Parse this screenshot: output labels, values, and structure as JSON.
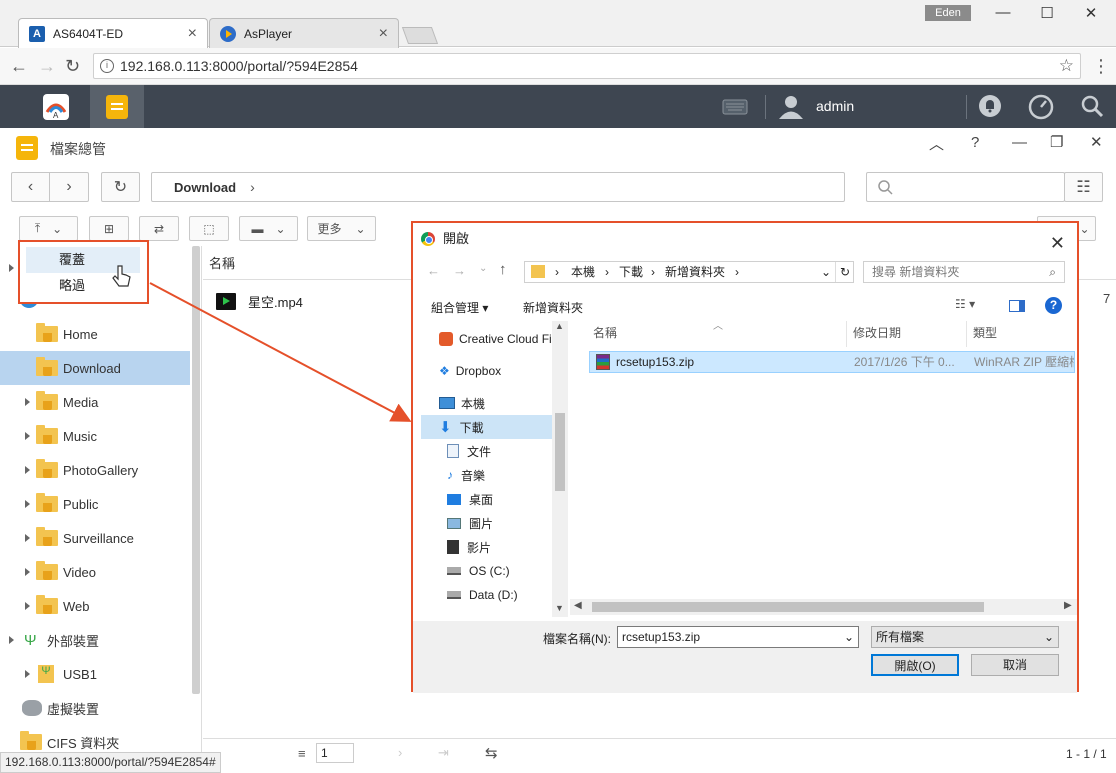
{
  "browser": {
    "tabs": [
      {
        "label": "AS6404T-ED",
        "favicon": "asustor-logo-icon"
      },
      {
        "label": "AsPlayer",
        "favicon": "play-icon"
      }
    ],
    "user_badge": "Eden",
    "url": "192.168.0.113:8000/portal/?594E2854",
    "status_url": "192.168.0.113:8000/portal/?594E2854#"
  },
  "adm": {
    "username": "admin"
  },
  "file_explorer": {
    "title": "檔案總管",
    "breadcrumb": "Download",
    "toolbar": {
      "more_label": "更多"
    },
    "context_menu": [
      "覆蓋",
      "略過"
    ],
    "sidebar": {
      "items": [
        {
          "label": "Home",
          "type": "folder",
          "expandable": false,
          "selected": false
        },
        {
          "label": "Download",
          "type": "folder",
          "expandable": false,
          "selected": true
        },
        {
          "label": "Media",
          "type": "folder",
          "expandable": true,
          "selected": false
        },
        {
          "label": "Music",
          "type": "folder",
          "expandable": true,
          "selected": false
        },
        {
          "label": "PhotoGallery",
          "type": "folder",
          "expandable": true,
          "selected": false
        },
        {
          "label": "Public",
          "type": "folder",
          "expandable": true,
          "selected": false
        },
        {
          "label": "Surveillance",
          "type": "folder",
          "expandable": true,
          "selected": false
        },
        {
          "label": "Video",
          "type": "folder",
          "expandable": true,
          "selected": false
        },
        {
          "label": "Web",
          "type": "folder",
          "expandable": true,
          "selected": false
        }
      ],
      "external_devices": "外部裝置",
      "usb": "USB1",
      "virtual_devices": "虛擬裝置",
      "cifs": "CIFS 資料夾"
    },
    "main": {
      "column_name": "名稱",
      "files": [
        {
          "name": "星空.mp4",
          "icon": "video-file-icon"
        }
      ],
      "right_digit": "7"
    },
    "pager": {
      "page": "1",
      "summary": "1 - 1 / 1"
    }
  },
  "dialog": {
    "title": "開啟",
    "path": [
      "本機",
      "下載",
      "新增資料夾"
    ],
    "search_placeholder": "搜尋 新增資料夾",
    "organize": "組合管理",
    "new_folder": "新增資料夾",
    "nav_items": [
      {
        "label": "Creative Cloud Fi",
        "icon": "creative-cloud-icon"
      },
      {
        "label": "Dropbox",
        "icon": "dropbox-icon"
      },
      {
        "label": "本機",
        "icon": "this-pc-icon"
      },
      {
        "label": "下載",
        "icon": "download-icon",
        "selected": true
      },
      {
        "label": "文件",
        "icon": "documents-icon"
      },
      {
        "label": "音樂",
        "icon": "music-icon"
      },
      {
        "label": "桌面",
        "icon": "desktop-icon"
      },
      {
        "label": "圖片",
        "icon": "pictures-icon"
      },
      {
        "label": "影片",
        "icon": "videos-icon"
      },
      {
        "label": "OS (C:)",
        "icon": "drive-c-icon"
      },
      {
        "label": "Data (D:)",
        "icon": "drive-d-icon"
      }
    ],
    "columns": [
      "名稱",
      "修改日期",
      "類型"
    ],
    "file": {
      "name": "rcsetup153.zip",
      "modified": "2017/1/26 下午 0...",
      "type": "WinRAR ZIP 壓縮檔"
    },
    "filename_label": "檔案名稱(N):",
    "filename_value": "rcsetup153.zip",
    "filetype_value": "所有檔案",
    "open_button": "開啟(O)",
    "cancel_button": "取消"
  },
  "colors": {
    "accent_orange": "#e5502a",
    "selection_blue": "#b8d4ef",
    "adm_bar": "#3e4651"
  }
}
